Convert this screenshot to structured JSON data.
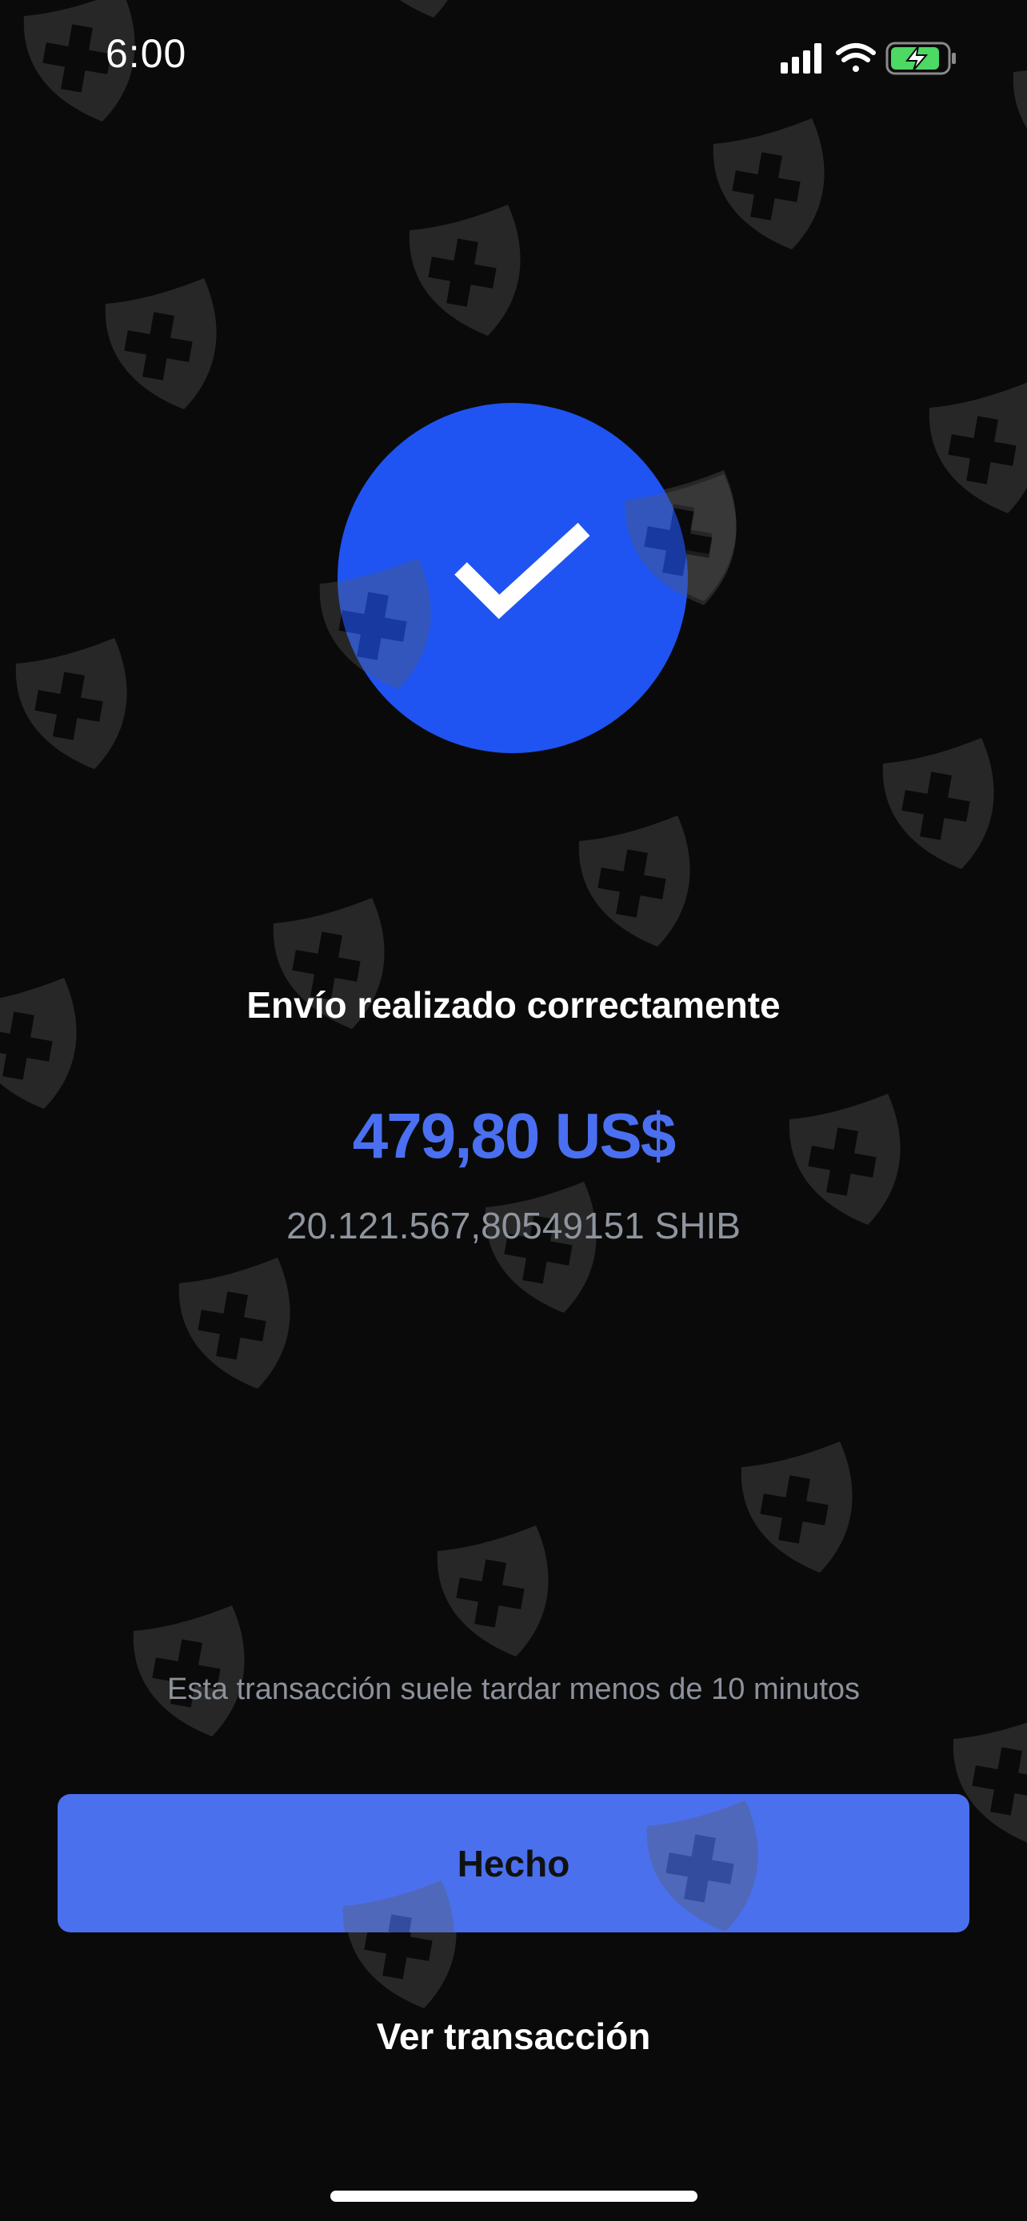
{
  "status_bar": {
    "time": "6:00",
    "icons": [
      "cellular-signal-icon",
      "wifi-icon",
      "battery-charging-icon"
    ],
    "battery_color": "#4cd964"
  },
  "background": {
    "pattern_icon": "shield-plus-icon",
    "color": "#0a0a0a"
  },
  "success": {
    "icon": "checkmark-icon",
    "circle_color": "#1f54f2",
    "title": "Envío realizado correctamente",
    "amount": "479,80 US$",
    "amount_color": "#4a6ff0",
    "crypto_amount": "20.121.567,80549151 SHIB"
  },
  "note": "Esta transacción suele tardar menos de 10 minutos",
  "actions": {
    "done_label": "Hecho",
    "done_color": "#4a70ee",
    "view_label": "Ver transacción"
  }
}
